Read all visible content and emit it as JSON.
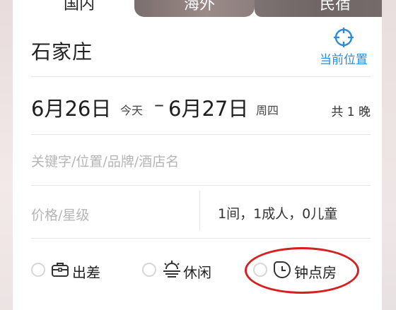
{
  "tabs": [
    {
      "label": "国内",
      "active": true
    },
    {
      "label": "海外",
      "active": false
    },
    {
      "label": "民宿",
      "active": false
    }
  ],
  "destination": {
    "city": "石家庄",
    "locate_label": "当前位置",
    "locate_icon": "crosshair-icon"
  },
  "dates": {
    "check_in": "6月26日",
    "check_in_day": "今天",
    "separator": "–",
    "check_out": "6月27日",
    "check_out_day": "周四",
    "nights": "共 1 晚"
  },
  "search": {
    "keyword_placeholder": "关键字/位置/品牌/酒店名"
  },
  "filters": {
    "price_placeholder": "价格/星级",
    "guests": "1间，1成人，0儿童"
  },
  "trip_types": [
    {
      "label": "出差",
      "icon": "briefcase-icon",
      "selected": false
    },
    {
      "label": "休闲",
      "icon": "sun-cloud-icon",
      "selected": false
    },
    {
      "label": "钟点房",
      "icon": "clock-icon",
      "selected": false,
      "highlighted": true
    }
  ],
  "colors": {
    "accent_blue": "#2f8ad8",
    "highlight_red": "#d81f1f"
  }
}
